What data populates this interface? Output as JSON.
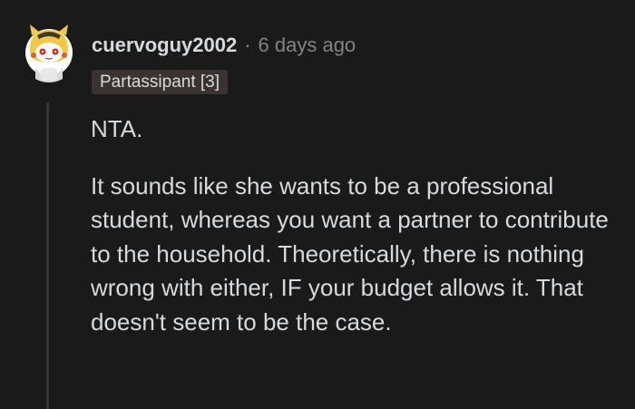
{
  "comment": {
    "author": "cuervoguy2002",
    "separator": "·",
    "time": "6 days ago",
    "flair": "Partassipant [3]",
    "paragraphs": [
      "NTA.",
      "It sounds like she wants to be a professional student, whereas you want a partner to contribute to the household. Theoretically, there is nothing wrong with either, IF your budget allows it. That doesn't seem to be the case."
    ],
    "avatar_icon": "snoo-avatar-icon"
  },
  "colors": {
    "background": "#1a1a1b",
    "text": "#d7dadc",
    "meta": "#818384",
    "flair_bg": "#3b3330",
    "thread_line": "#343536"
  }
}
